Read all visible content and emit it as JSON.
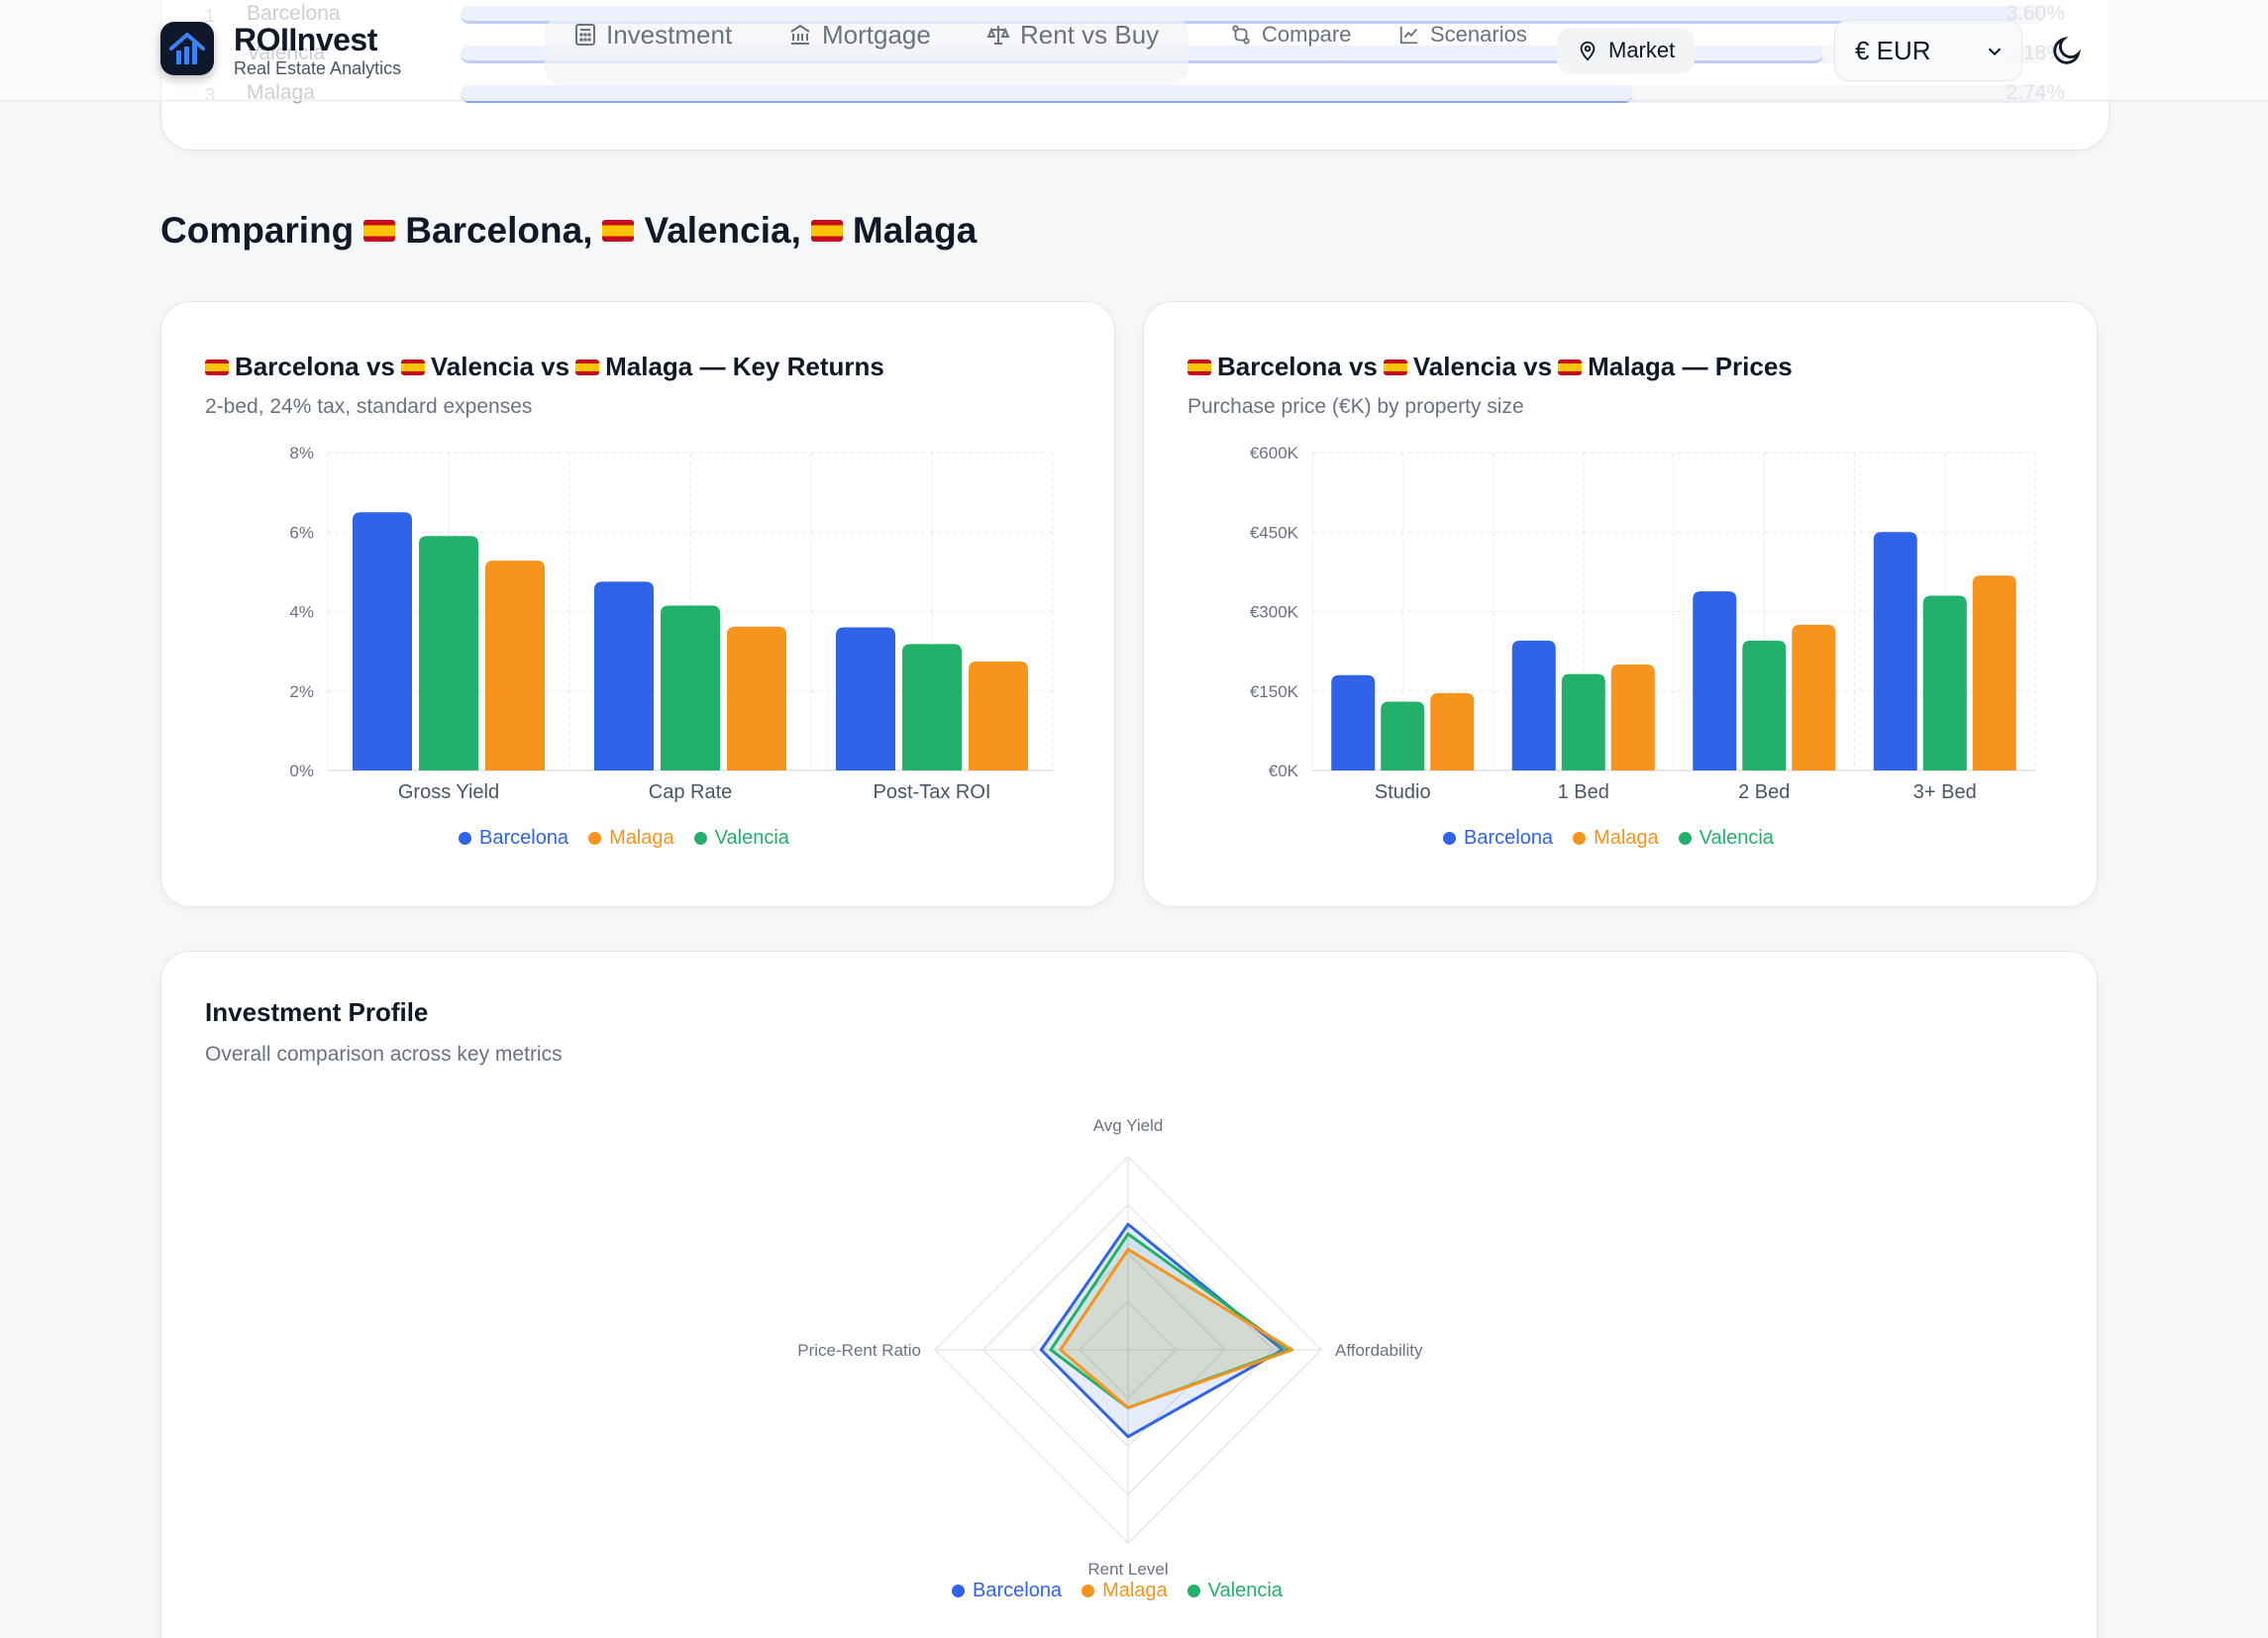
{
  "app": {
    "brand": "ROIInvest",
    "tagline": "Real Estate Analytics",
    "nav": {
      "investment": "Investment",
      "mortgage": "Mortgage",
      "rent_vs_buy": "Rent vs Buy",
      "compare": "Compare",
      "scenarios": "Scenarios",
      "market": "Market"
    },
    "currency": "€ EUR"
  },
  "ranking": [
    {
      "rank": "1",
      "name": "Barcelona",
      "value": "3.60%",
      "fraction": 0.98
    },
    {
      "rank": "2",
      "name": "Valencia",
      "value": "3.18%",
      "fraction": 0.86
    },
    {
      "rank": "3",
      "name": "Malaga",
      "value": "2.74%",
      "fraction": 0.74
    }
  ],
  "comparison": {
    "title_prefix": "Comparing",
    "cities": [
      "Barcelona,",
      "Valencia,",
      "Malaga"
    ]
  },
  "cards": {
    "returns": {
      "title": "Barcelona vs  Valencia vs  Malaga — Key Returns",
      "title_parts": [
        "Barcelona vs",
        "Valencia vs",
        "Malaga — Key Returns"
      ],
      "subtitle": "2-bed, 24% tax, standard expenses"
    },
    "prices": {
      "title_parts": [
        "Barcelona vs",
        "Valencia vs",
        "Malaga — Prices"
      ],
      "subtitle": "Purchase price (€K) by property size"
    },
    "profile": {
      "title": "Investment Profile",
      "subtitle": "Overall comparison across key metrics"
    }
  },
  "colors": {
    "barcelona": "#2f64e8",
    "valencia": "#22b06b",
    "malaga": "#f7941d",
    "grid": "#e5e7eb",
    "tick": "#6b7280"
  },
  "legend": {
    "barcelona": "Barcelona",
    "malaga": "Malaga",
    "valencia": "Valencia"
  },
  "chart_data": [
    {
      "type": "bar",
      "categories": [
        "Gross Yield",
        "Cap Rate",
        "Post-Tax ROI"
      ],
      "series": [
        {
          "name": "Barcelona",
          "values": [
            6.5,
            4.75,
            3.6
          ]
        },
        {
          "name": "Valencia",
          "values": [
            5.9,
            4.15,
            3.18
          ]
        },
        {
          "name": "Malaga",
          "values": [
            5.28,
            3.62,
            2.74
          ]
        }
      ],
      "yticks": [
        "0%",
        "2%",
        "4%",
        "6%",
        "8%"
      ],
      "ylim": [
        0,
        8
      ],
      "grid": true,
      "legend": "bottom"
    },
    {
      "type": "bar",
      "categories": [
        "Studio",
        "1 Bed",
        "2 Bed",
        "3+ Bed"
      ],
      "series": [
        {
          "name": "Barcelona",
          "values": [
            180,
            245,
            338,
            450
          ]
        },
        {
          "name": "Valencia",
          "values": [
            130,
            182,
            245,
            330
          ]
        },
        {
          "name": "Malaga",
          "values": [
            146,
            200,
            275,
            368
          ]
        }
      ],
      "yticks": [
        "€0K",
        "€150K",
        "€300K",
        "€450K",
        "€600K"
      ],
      "ylim": [
        0,
        600
      ],
      "grid": true,
      "legend": "bottom"
    },
    {
      "type": "radar",
      "axes": [
        "Avg Yield",
        "Affordability",
        "Rent Level",
        "Price-Rent Ratio"
      ],
      "series": [
        {
          "name": "Barcelona",
          "values": [
            65,
            80,
            45,
            45
          ]
        },
        {
          "name": "Valencia",
          "values": [
            60,
            83,
            30,
            40
          ]
        },
        {
          "name": "Malaga",
          "values": [
            52,
            85,
            30,
            35
          ]
        }
      ],
      "range": [
        0,
        100
      ],
      "legend": "bottom"
    }
  ]
}
